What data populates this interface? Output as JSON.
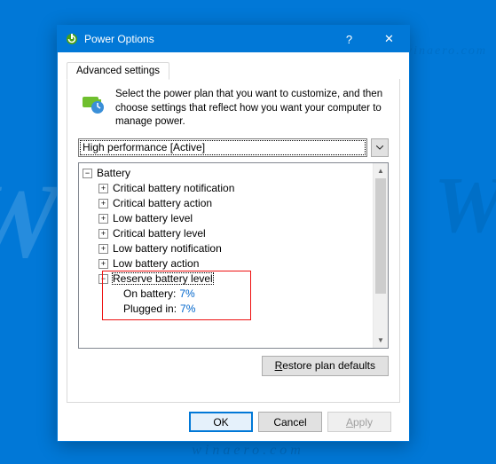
{
  "watermark": {
    "big": "W",
    "url": "winaero.com",
    "url2": "http://winaero.com"
  },
  "titlebar": {
    "title": "Power Options",
    "help": "?",
    "close": "✕"
  },
  "tab": {
    "label": "Advanced settings"
  },
  "intro": {
    "text": "Select the power plan that you want to customize, and then choose settings that reflect how you want your computer to manage power."
  },
  "plan": {
    "selected": "High performance [Active]"
  },
  "tree": {
    "root": "Battery",
    "items": [
      "Critical battery notification",
      "Critical battery action",
      "Low battery level",
      "Critical battery level",
      "Low battery notification",
      "Low battery action"
    ],
    "expanded": {
      "label": "Reserve battery level",
      "onbat_label": "On battery:",
      "onbat_value": "7%",
      "plugged_label": "Plugged in:",
      "plugged_value": "7%"
    }
  },
  "buttons": {
    "restore_pre": "R",
    "restore_post": "estore plan defaults",
    "ok": "OK",
    "cancel": "Cancel",
    "apply_pre": "A",
    "apply_post": "pply"
  }
}
